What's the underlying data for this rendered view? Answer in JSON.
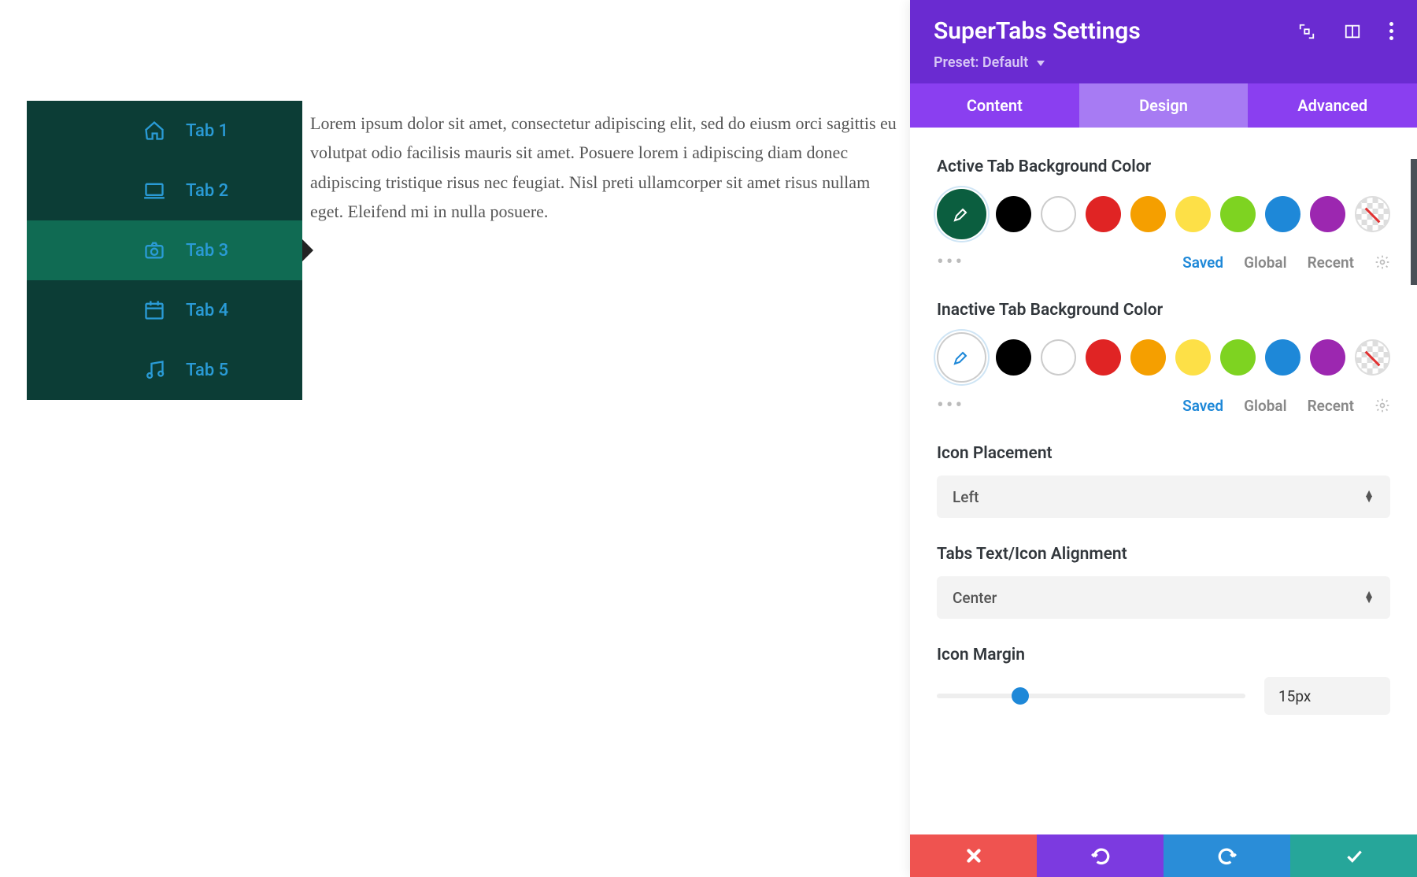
{
  "preview": {
    "tabs": [
      {
        "label": "Tab 1",
        "icon": "home-icon"
      },
      {
        "label": "Tab 2",
        "icon": "laptop-icon"
      },
      {
        "label": "Tab 3",
        "icon": "camera-icon",
        "active": true
      },
      {
        "label": "Tab 4",
        "icon": "calendar-icon"
      },
      {
        "label": "Tab 5",
        "icon": "music-icon"
      }
    ],
    "body_text": "Lorem ipsum dolor sit amet, consectetur adipiscing elit, sed do eiusm orci sagittis eu volutpat odio facilisis mauris sit amet. Posuere lorem i adipiscing diam donec adipiscing tristique risus nec feugiat. Nisl preti ullamcorper sit amet risus nullam eget. Eleifend mi in nulla posuere."
  },
  "panel": {
    "title": "SuperTabs Settings",
    "preset": "Preset: Default",
    "tabs": {
      "content": "Content",
      "design": "Design",
      "advanced": "Advanced",
      "active": "design"
    },
    "swatch_palette": [
      "#000000",
      "#ffffff",
      "#e02424",
      "#f59f00",
      "#fde047",
      "#7ed321",
      "#1e88d8",
      "#9c27b0"
    ],
    "swatch_tabs": {
      "saved": "Saved",
      "global": "Global",
      "recent": "Recent"
    },
    "active_bg": {
      "label": "Active Tab Background Color",
      "current_color": "#0b5e3f",
      "eyedrop_stroke": "#ffffff"
    },
    "inactive_bg": {
      "label": "Inactive Tab Background Color",
      "current_color": "#ffffff",
      "eyedrop_stroke": "#1e88d8",
      "outlined": true
    },
    "icon_placement": {
      "label": "Icon Placement",
      "value": "Left"
    },
    "text_align": {
      "label": "Tabs Text/Icon Alignment",
      "value": "Center"
    },
    "icon_margin": {
      "label": "Icon Margin",
      "value": "15px",
      "knob_percent": 27
    },
    "footer": {
      "cancel": "cancel",
      "undo": "undo",
      "redo": "redo",
      "ok": "confirm"
    }
  }
}
